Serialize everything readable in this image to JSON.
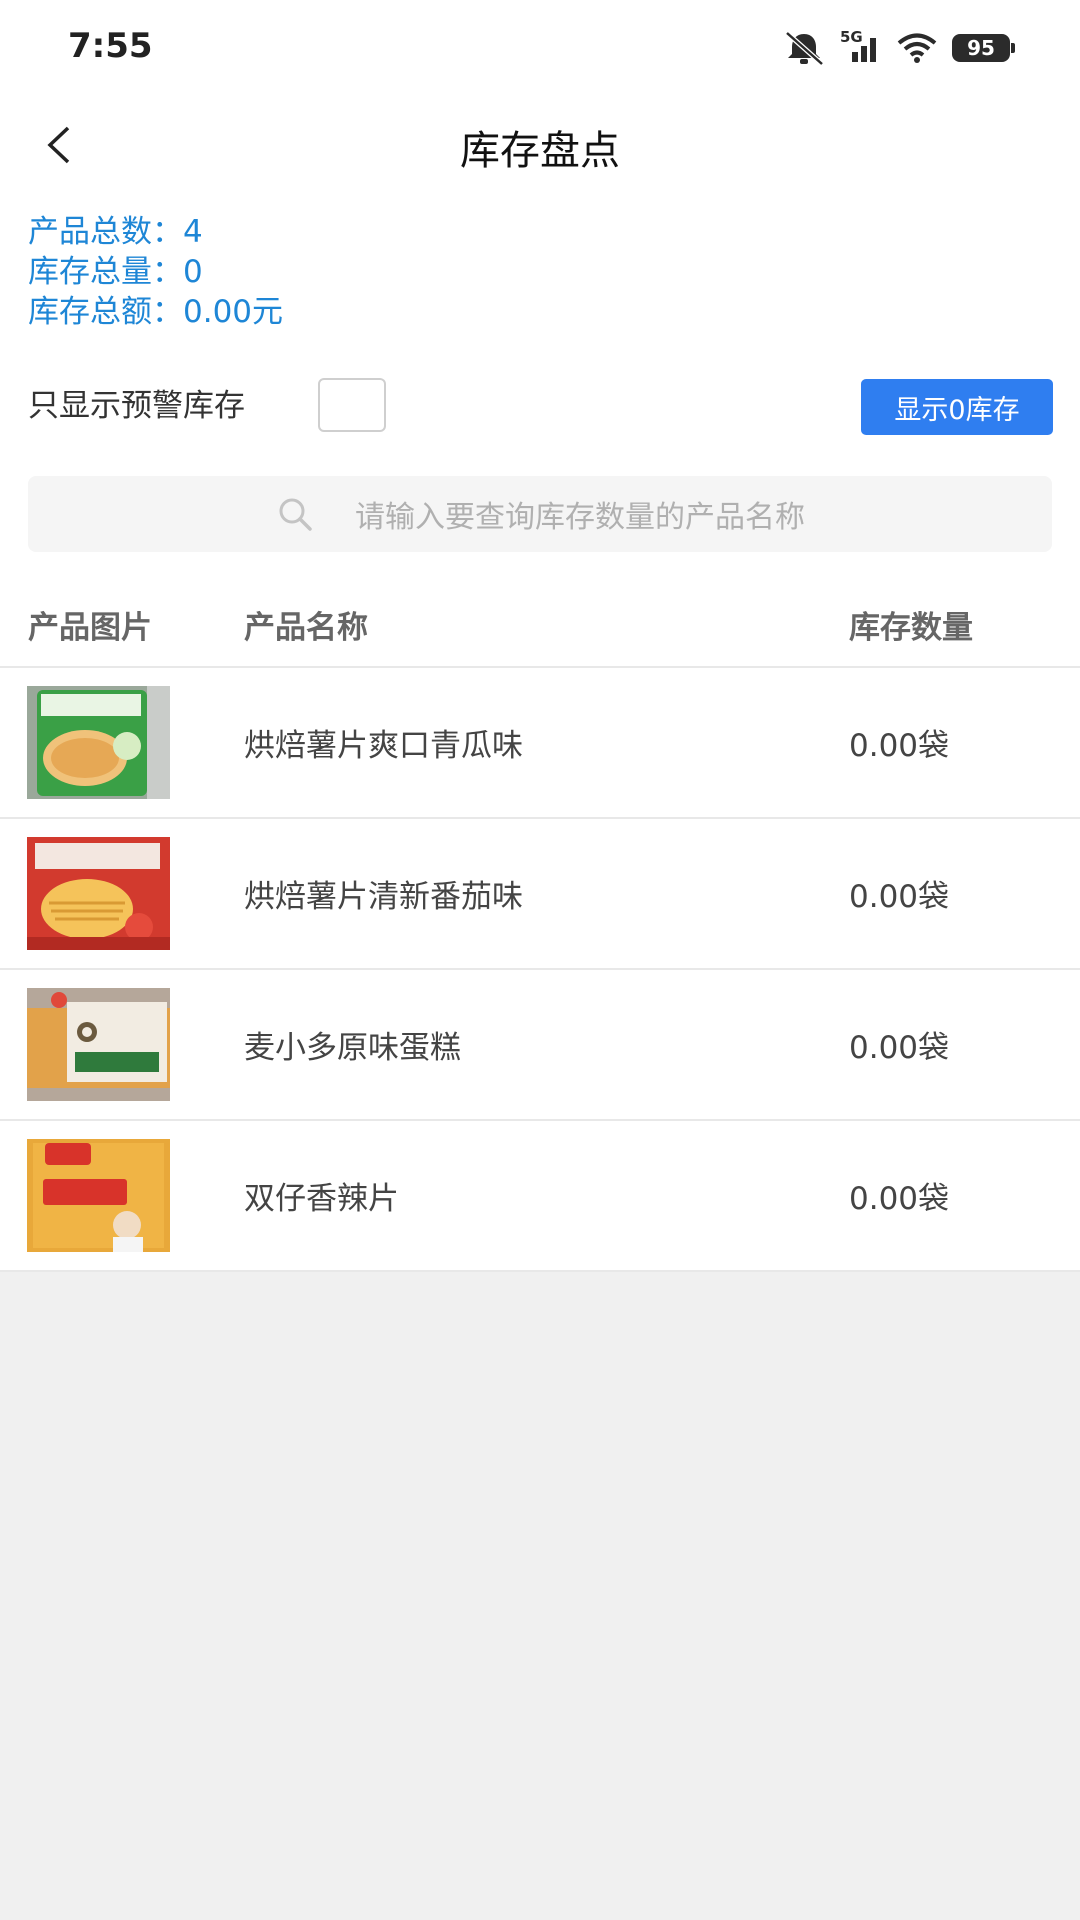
{
  "status_bar": {
    "time": "7:55",
    "network": "5G",
    "battery": "95",
    "icons": [
      "bell-muted-icon",
      "signal-icon",
      "wifi-icon",
      "battery-icon"
    ]
  },
  "header": {
    "title": "库存盘点",
    "back_icon": "chevron-left-icon"
  },
  "summary": {
    "product_count_label": "产品总数：",
    "product_count": "4",
    "stock_total_label": "库存总量：",
    "stock_total": "0",
    "stock_amount_label": "库存总额：",
    "stock_amount": "0.00元"
  },
  "filter": {
    "warning_only_label": "只显示预警库存",
    "warning_only_checked": false,
    "show_zero_button": "显示0库存"
  },
  "search": {
    "placeholder": "请输入要查询库存数量的产品名称",
    "icon": "search-icon"
  },
  "table": {
    "headers": {
      "image": "产品图片",
      "name": "产品名称",
      "quantity": "库存数量"
    },
    "rows": [
      {
        "name": "烘焙薯片爽口青瓜味",
        "quantity": "0.00袋"
      },
      {
        "name": "烘焙薯片清新番茄味",
        "quantity": "0.00袋"
      },
      {
        "name": "麦小多原味蛋糕",
        "quantity": "0.00袋"
      },
      {
        "name": "双仔香辣片",
        "quantity": "0.00袋"
      }
    ]
  },
  "colors": {
    "accent": "#2f7ef0",
    "summary_text": "#1e86d6",
    "page_bg": "#f0f0f0"
  }
}
